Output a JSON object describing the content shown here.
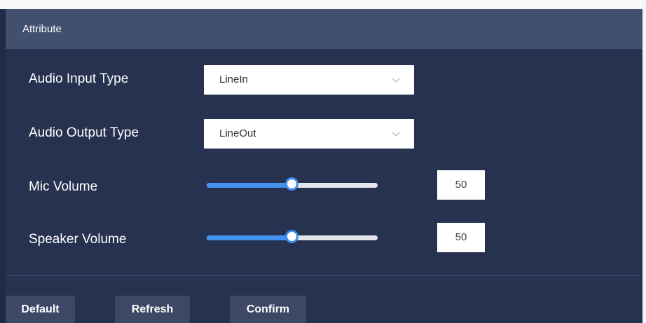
{
  "panel": {
    "title": "Attribute"
  },
  "fields": {
    "audio_input": {
      "label": "Audio Input Type",
      "value": "LineIn"
    },
    "audio_output": {
      "label": "Audio Output Type",
      "value": "LineOut"
    },
    "mic_volume": {
      "label": "Mic Volume",
      "value": "50",
      "level": 50
    },
    "speaker_volume": {
      "label": "Speaker Volume",
      "value": "50",
      "level": 50
    }
  },
  "buttons": {
    "default": "Default",
    "refresh": "Refresh",
    "confirm": "Confirm"
  },
  "colors": {
    "background": "#222b45",
    "header": "#42506f",
    "accent": "#4294f0",
    "button": "#3c4865"
  },
  "icons": {
    "select_caret": "chevron-down-icon",
    "slider_handle": "slider-thumb"
  }
}
